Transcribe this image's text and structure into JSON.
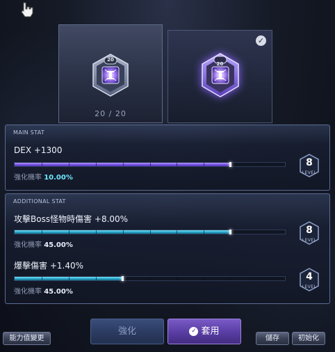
{
  "top_items": [
    {
      "level_badge": "20",
      "counter": "20 / 20"
    },
    {
      "level_badge": "20",
      "checked": true
    }
  ],
  "main_stat": {
    "title": "MAIN STAT",
    "stats": [
      {
        "name": "DEX +1300",
        "rate_label": "強化機率",
        "rate_value": "10.00%",
        "level": "8",
        "level_caption": "LEVEL",
        "progress": 0.8
      }
    ]
  },
  "additional_stat": {
    "title": "ADDITIONAL STAT",
    "stats": [
      {
        "name": "攻擊Boss怪物時傷害 +8.00%",
        "rate_label": "強化機率",
        "rate_value": "45.00%",
        "level": "8",
        "level_caption": "LEVEL",
        "progress": 0.8
      },
      {
        "name": "爆擊傷害 +1.40%",
        "rate_label": "強化機率",
        "rate_value": "45.00%",
        "level": "4",
        "level_caption": "LEVEL",
        "progress": 0.4
      }
    ]
  },
  "buttons": {
    "change_stat": "能力值變更",
    "upgrade": "強化",
    "apply": "套用",
    "save": "儲存",
    "reset": "初始化"
  },
  "colors": {
    "main_bar": "#7a56e8",
    "additional_bar": "#2aa9cc",
    "apply_button": "#5b3fa6",
    "upgrade_button": "#2c3c62"
  }
}
